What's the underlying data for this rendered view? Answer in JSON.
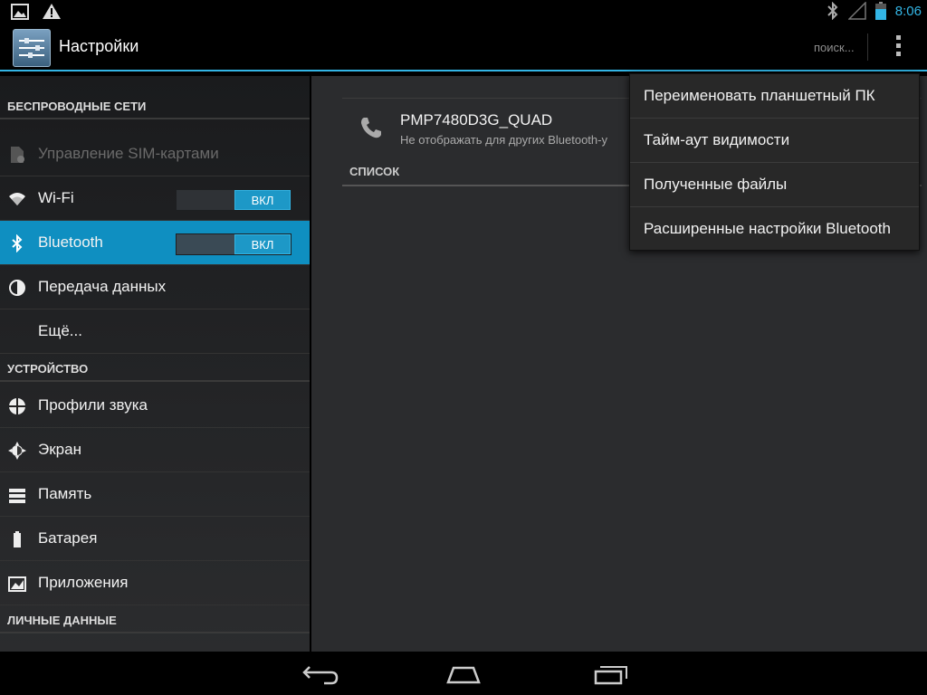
{
  "status_bar": {
    "time": "8:06",
    "left_icons": [
      "image-notification-icon",
      "warning-icon"
    ],
    "right_icons": [
      "bluetooth-icon",
      "signal-icon",
      "battery-icon"
    ]
  },
  "action_bar": {
    "title": "Настройки",
    "search_label": "поиск...",
    "app_icon": "settings-icon",
    "overflow_icon": "overflow-menu-icon"
  },
  "sidebar": {
    "sections": [
      {
        "header": "БЕСПРОВОДНЫЕ СЕТИ",
        "items": [
          {
            "label": "Управление SIM-картами",
            "icon": "sim-icon",
            "disabled": true
          },
          {
            "label": "Wi-Fi",
            "icon": "wifi-icon",
            "toggle": "ВКЛ"
          },
          {
            "label": "Bluetooth",
            "icon": "bluetooth-icon",
            "toggle": "ВКЛ",
            "selected": true
          },
          {
            "label": "Передача данных",
            "icon": "data-usage-icon"
          },
          {
            "label": "Ещё..."
          }
        ]
      },
      {
        "header": "УСТРОЙСТВО",
        "items": [
          {
            "label": "Профили звука",
            "icon": "sound-icon"
          },
          {
            "label": "Экран",
            "icon": "display-icon"
          },
          {
            "label": "Память",
            "icon": "storage-icon"
          },
          {
            "label": "Батарея",
            "icon": "battery-icon"
          },
          {
            "label": "Приложения",
            "icon": "apps-icon"
          }
        ]
      },
      {
        "header": "ЛИЧНЫЕ ДАННЫЕ",
        "items": []
      }
    ]
  },
  "bluetooth_panel": {
    "device_name": "PMP7480D3G_QUAD",
    "device_status": "Не отображать для других Bluetooth-у",
    "list_header": "СПИСОК"
  },
  "popup_menu": {
    "items": [
      "Переименовать планшетный ПК",
      "Тайм-аут видимости",
      "Полученные файлы",
      "Расширенные настройки Bluetooth"
    ]
  },
  "nav_bar": {
    "buttons": [
      "back-icon",
      "home-icon",
      "recent-apps-icon"
    ]
  },
  "colors": {
    "accent": "#33b5e5",
    "selected_bg": "#0f8fc1"
  }
}
